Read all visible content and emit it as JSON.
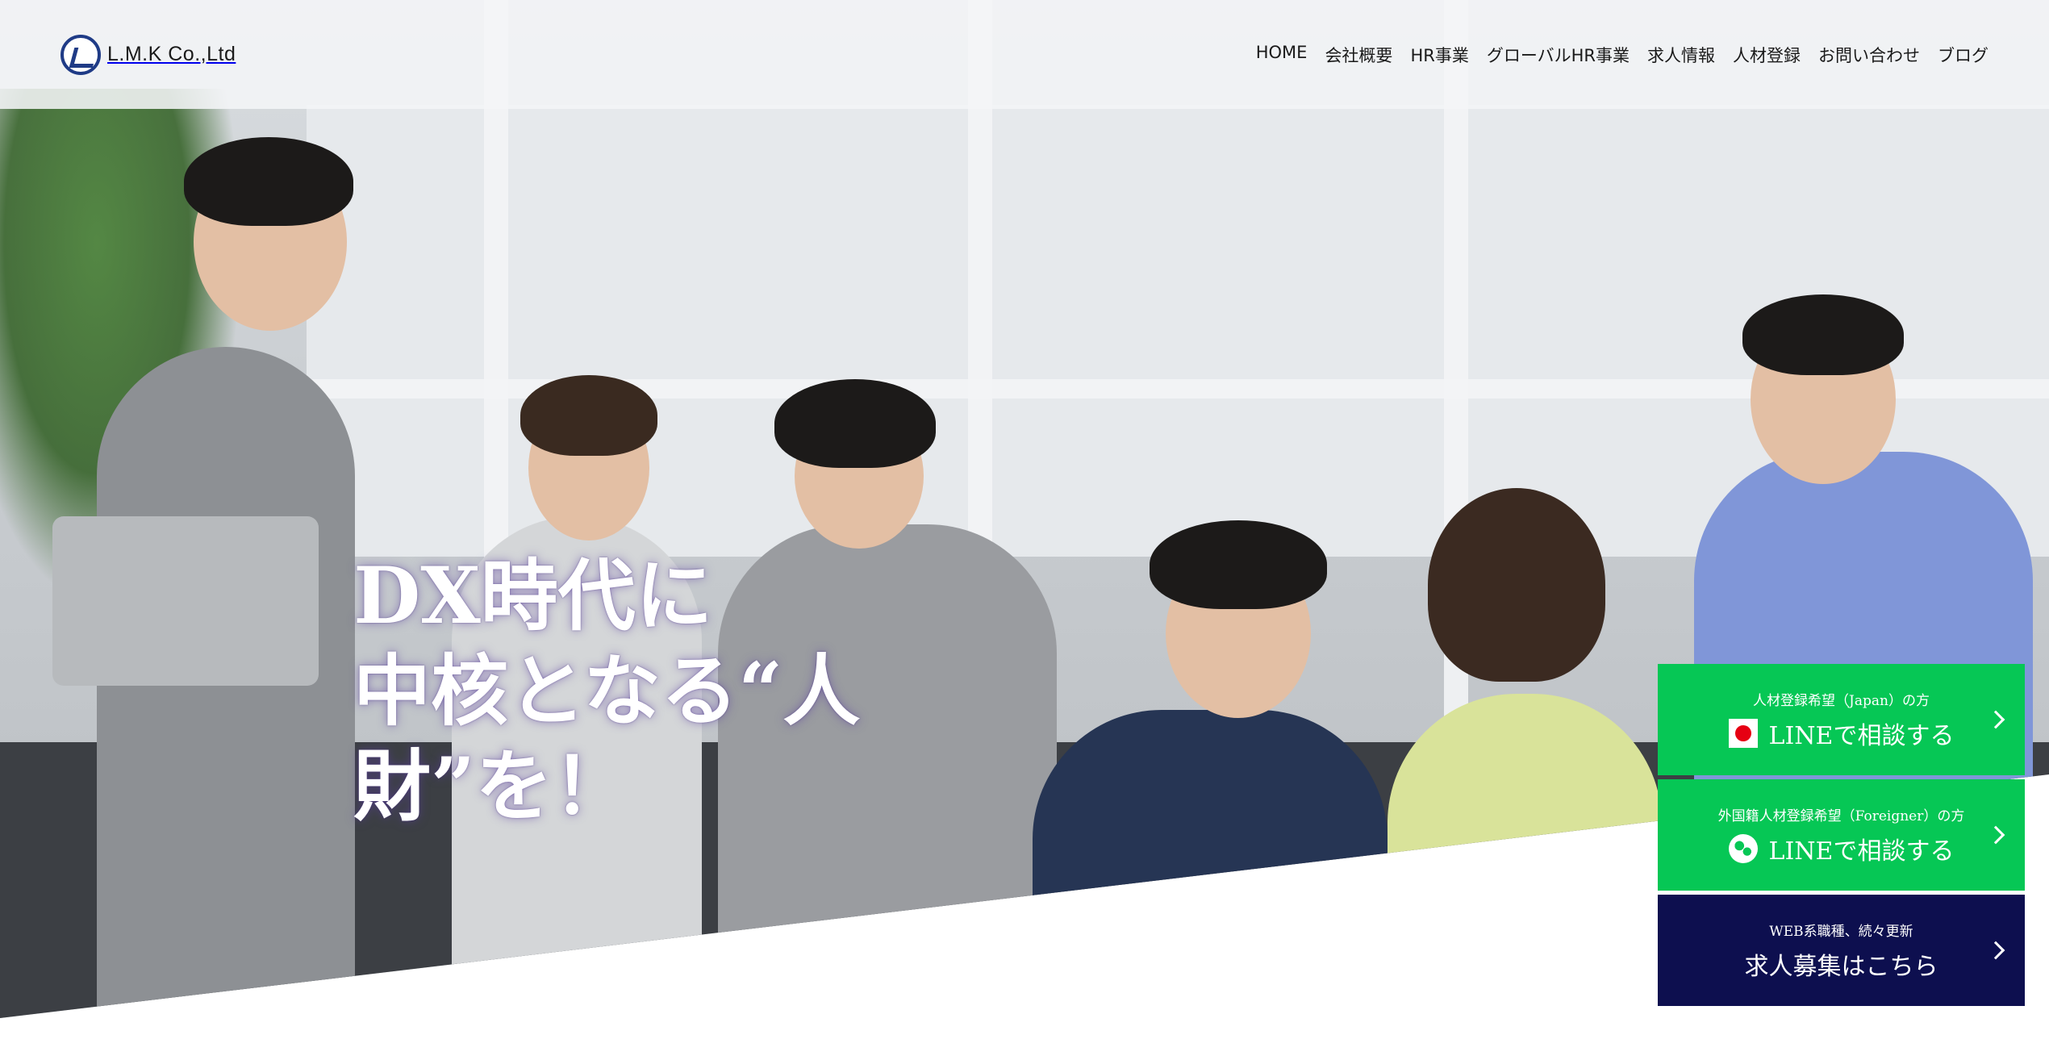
{
  "brand": {
    "name": "L.M.K Co.,Ltd"
  },
  "nav": {
    "items": [
      "HOME",
      "会社概要",
      "HR事業",
      "グローバルHR事業",
      "求人情報",
      "人材登録",
      "お問い合わせ",
      "ブログ"
    ]
  },
  "hero": {
    "line1": "DX時代に",
    "line2": "中核となる“人財”を！"
  },
  "cta": {
    "japan": {
      "small": "人材登録希望（Japan）の方",
      "big": "LINEで相談する"
    },
    "foreigner": {
      "small": "外国籍人材登録希望（Foreigner）の方",
      "big": "LINEで相談する"
    },
    "jobs": {
      "small": "WEB系職種、続々更新",
      "big": "求人募集はこちら"
    }
  },
  "colors": {
    "line_green": "#06c755",
    "navy": "#0d0f4f",
    "logo_blue": "#1f3b86"
  },
  "icons": [
    "logo-mark-icon",
    "japan-flag-icon",
    "globe-icon",
    "chevron-right-icon"
  ]
}
